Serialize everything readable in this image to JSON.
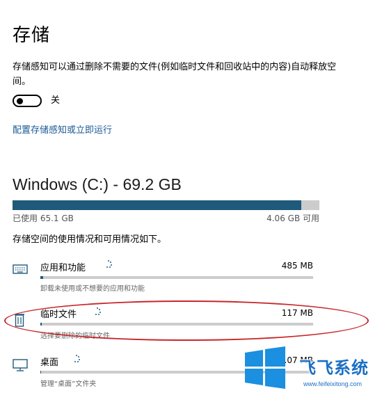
{
  "page": {
    "title": "存储",
    "description": "存储感知可以通过删除不需要的文件(例如临时文件和回收站中的内容)自动释放空间。",
    "toggle_state": "关",
    "config_link": "配置存储感知或立即运行"
  },
  "drive": {
    "title": "Windows (C:) - 69.2 GB",
    "used_label": "已使用 65.1 GB",
    "free_label": "4.06 GB 可用",
    "used_gb": 65.1,
    "total_gb": 69.2,
    "bar_color": "#1f5a7a"
  },
  "usage": {
    "summary": "存储空间的使用情况和可用情况如下。",
    "categories": [
      {
        "name": "应用和功能",
        "size": "485 MB",
        "desc": "卸载未使用或不想要的应用和功能",
        "icon": "keyboard-icon",
        "fill_fraction": 0.01
      },
      {
        "name": "临时文件",
        "size": "117 MB",
        "desc": "选择要删除的临时文件",
        "icon": "trash-icon",
        "fill_fraction": 0.005
      },
      {
        "name": "桌面",
        "size": "1.07 MB",
        "desc": "管理“桌面”文件夹",
        "icon": "monitor-icon",
        "fill_fraction": 0.002
      }
    ]
  },
  "annotation": {
    "highlight_color": "#c8262b"
  },
  "watermark": {
    "title": "飞飞系统",
    "url": "www.feifeixitong.com",
    "color": "#1b6fc4"
  }
}
